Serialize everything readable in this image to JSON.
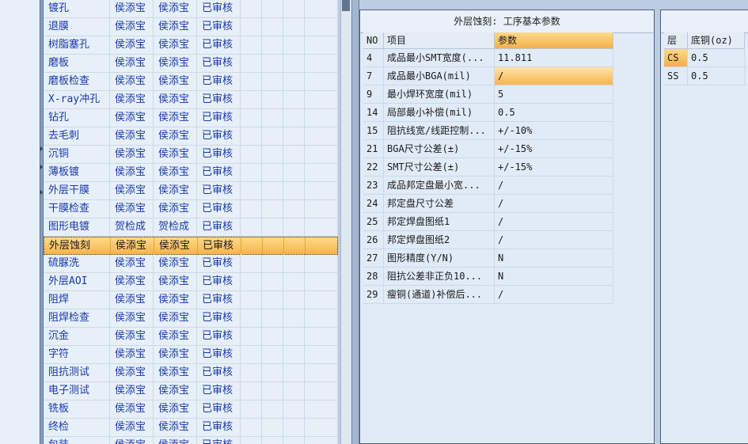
{
  "process_list": {
    "rows": [
      {
        "name": "镀孔",
        "maker": "侯添宝",
        "checker": "侯添宝",
        "status": "已审核"
      },
      {
        "name": "退膜",
        "maker": "侯添宝",
        "checker": "侯添宝",
        "status": "已审核"
      },
      {
        "name": "树脂塞孔",
        "maker": "侯添宝",
        "checker": "侯添宝",
        "status": "已审核"
      },
      {
        "name": "磨板",
        "maker": "侯添宝",
        "checker": "侯添宝",
        "status": "已审核"
      },
      {
        "name": "磨板检查",
        "maker": "侯添宝",
        "checker": "侯添宝",
        "status": "已审核"
      },
      {
        "name": "X-ray冲孔",
        "maker": "侯添宝",
        "checker": "侯添宝",
        "status": "已审核"
      },
      {
        "name": "钻孔",
        "maker": "侯添宝",
        "checker": "侯添宝",
        "status": "已审核"
      },
      {
        "name": "去毛刺",
        "maker": "侯添宝",
        "checker": "侯添宝",
        "status": "已审核"
      },
      {
        "name": "沉铜",
        "maker": "侯添宝",
        "checker": "侯添宝",
        "status": "已审核"
      },
      {
        "name": "薄板镀",
        "maker": "侯添宝",
        "checker": "侯添宝",
        "status": "已审核"
      },
      {
        "name": "外层干膜",
        "maker": "侯添宝",
        "checker": "侯添宝",
        "status": "已审核"
      },
      {
        "name": "干膜检查",
        "maker": "侯添宝",
        "checker": "侯添宝",
        "status": "已审核"
      },
      {
        "name": "图形电镀",
        "maker": "贺检成",
        "checker": "贺检成",
        "status": "已审核"
      },
      {
        "name": "外层蚀刻",
        "maker": "侯添宝",
        "checker": "侯添宝",
        "status": "已审核"
      },
      {
        "name": "硫脲洗",
        "maker": "侯添宝",
        "checker": "侯添宝",
        "status": "已审核"
      },
      {
        "name": "外层AOI",
        "maker": "侯添宝",
        "checker": "侯添宝",
        "status": "已审核"
      },
      {
        "name": "阻焊",
        "maker": "侯添宝",
        "checker": "侯添宝",
        "status": "已审核"
      },
      {
        "name": "阻焊检查",
        "maker": "侯添宝",
        "checker": "侯添宝",
        "status": "已审核"
      },
      {
        "name": "沉金",
        "maker": "侯添宝",
        "checker": "侯添宝",
        "status": "已审核"
      },
      {
        "name": "字符",
        "maker": "侯添宝",
        "checker": "侯添宝",
        "status": "已审核"
      },
      {
        "name": "阻抗测试",
        "maker": "侯添宝",
        "checker": "侯添宝",
        "status": "已审核"
      },
      {
        "name": "电子测试",
        "maker": "侯添宝",
        "checker": "侯添宝",
        "status": "已审核"
      },
      {
        "name": "铣板",
        "maker": "侯添宝",
        "checker": "侯添宝",
        "status": "已审核"
      },
      {
        "name": "终检",
        "maker": "侯添宝",
        "checker": "侯添宝",
        "status": "已审核"
      },
      {
        "name": "包装",
        "maker": "侯添宝",
        "checker": "侯添宝",
        "status": "已审核"
      }
    ],
    "selected_index": 13
  },
  "param_panel": {
    "title": "外层蚀刻: 工序基本参数",
    "columns": {
      "no": "NO",
      "item": "项目",
      "value": "参数"
    },
    "rows": [
      {
        "no": "4",
        "item": "成品最小SMT宽度(...",
        "value": "11.811"
      },
      {
        "no": "7",
        "item": "成品最小BGA(mil)",
        "value": "/"
      },
      {
        "no": "9",
        "item": "最小焊环宽度(mil)",
        "value": "5"
      },
      {
        "no": "14",
        "item": "局部最小补偿(mil)",
        "value": "0.5"
      },
      {
        "no": "15",
        "item": "阻抗线宽/线距控制...",
        "value": "+/-10%"
      },
      {
        "no": "21",
        "item": "BGA尺寸公差(±)",
        "value": "+/-15%"
      },
      {
        "no": "22",
        "item": "SMT尺寸公差(±)",
        "value": "+/-15%"
      },
      {
        "no": "23",
        "item": "成品邦定盘最小宽...",
        "value": "/"
      },
      {
        "no": "24",
        "item": "邦定盘尺寸公差",
        "value": "/"
      },
      {
        "no": "25",
        "item": "邦定焊盘图纸1",
        "value": "/"
      },
      {
        "no": "26",
        "item": "邦定焊盘图纸2",
        "value": "/"
      },
      {
        "no": "27",
        "item": "图形精度(Y/N)",
        "value": "N"
      },
      {
        "no": "28",
        "item": "阻抗公差非正负10...",
        "value": "N"
      },
      {
        "no": "29",
        "item": "瘦铜(通道)补偿后...",
        "value": "/"
      }
    ],
    "highlighted_row": 1
  },
  "copper_panel": {
    "columns": {
      "layer": "层",
      "base_copper": "底铜(oz)"
    },
    "rows": [
      {
        "layer": "CS",
        "base_copper": "0.5"
      },
      {
        "layer": "SS",
        "base_copper": "0.5"
      }
    ]
  }
}
